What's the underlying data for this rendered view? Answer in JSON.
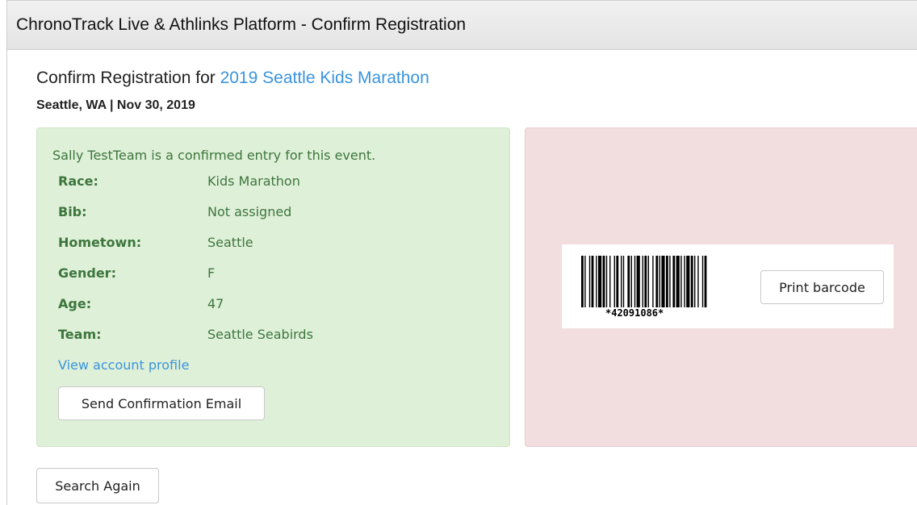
{
  "window": {
    "title": "ChronoTrack Live & Athlinks Platform - Confirm Registration"
  },
  "header": {
    "prefix": "Confirm Registration for ",
    "event_name": "2019 Seattle Kids Marathon",
    "subtitle": "Seattle, WA | Nov 30, 2019"
  },
  "entry": {
    "confirmation_text": "Sally TestTeam is a confirmed entry for this event.",
    "fields": [
      {
        "label": "Race:",
        "value": "Kids Marathon"
      },
      {
        "label": "Bib:",
        "value": "Not assigned"
      },
      {
        "label": "Hometown:",
        "value": "Seattle"
      },
      {
        "label": "Gender:",
        "value": "F"
      },
      {
        "label": "Age:",
        "value": "47"
      },
      {
        "label": "Team:",
        "value": "Seattle Seabirds"
      }
    ],
    "profile_link": "View account profile",
    "email_button": "Send Confirmation Email"
  },
  "barcode": {
    "text": "*42091086*",
    "print_button": "Print barcode"
  },
  "actions": {
    "search_again": "Search Again"
  },
  "colors": {
    "success_bg": "#dff0d8",
    "success_text": "#3c763d",
    "danger_bg": "#f2dede",
    "link": "#3a94dd"
  }
}
